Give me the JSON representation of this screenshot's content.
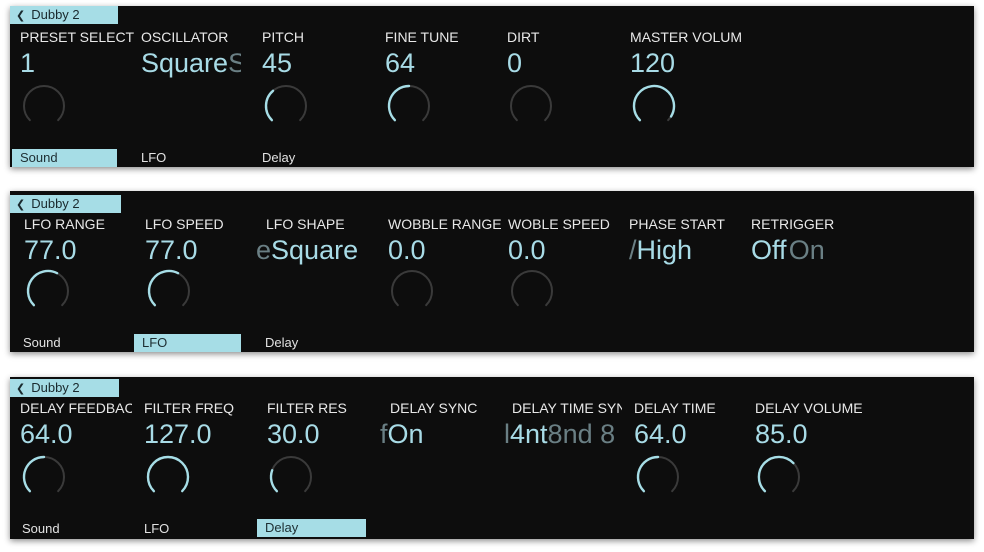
{
  "preset_name": "Dubby 2",
  "panels": [
    {
      "params": [
        {
          "label": "PRESET SELECT",
          "value": "1",
          "level": 0.0
        },
        {
          "label": "OSCILLATOR",
          "value": "Square",
          "ghost_after": "S",
          "level": null
        },
        {
          "label": "PITCH",
          "value": "45",
          "level": 0.35
        },
        {
          "label": "FINE TUNE",
          "value": "64",
          "level": 0.5
        },
        {
          "label": "DIRT",
          "value": "0",
          "level": 0.0
        },
        {
          "label": "MASTER VOLUME",
          "value": "120",
          "level": 0.95
        }
      ],
      "tabs": [
        "Sound",
        "LFO",
        "Delay"
      ],
      "active_tab": 0
    },
    {
      "params": [
        {
          "label": "LFO RANGE",
          "value": "77.0",
          "level": 0.6
        },
        {
          "label": "LFO SPEED",
          "value": "77.0",
          "level": 0.6
        },
        {
          "label": "LFO SHAPE",
          "value": "Square",
          "ghost_before": "e",
          "level": null
        },
        {
          "label": "WOBBLE RANGE",
          "value": "0.0",
          "level": 0.0
        },
        {
          "label": "WOBLE SPEED",
          "value": "0.0",
          "level": 0.0
        },
        {
          "label": "PHASE START",
          "value": "High",
          "ghost_before": "/",
          "level": null
        },
        {
          "label": "RETRIGGER",
          "value": "Off",
          "ghost_after": "On",
          "level": null
        }
      ],
      "tabs": [
        "Sound",
        "LFO",
        "Delay"
      ],
      "active_tab": 1
    },
    {
      "params": [
        {
          "label": "DELAY FEEDBACK",
          "value": "64.0",
          "level": 0.5
        },
        {
          "label": "FILTER FREQ",
          "value": "127.0",
          "level": 1.0
        },
        {
          "label": "FILTER RES",
          "value": "30.0",
          "level": 0.24
        },
        {
          "label": "DELAY SYNC",
          "value": "On",
          "ghost_before": "f",
          "level": null
        },
        {
          "label": "DELAY TIME SYNC",
          "value": "4nt",
          "ghost_before": "l",
          "ghost_after": "8nd 8",
          "level": null
        },
        {
          "label": "DELAY TIME",
          "value": "64.0",
          "level": 0.5
        },
        {
          "label": "DELAY VOLUME",
          "value": "85.0",
          "level": 0.67
        }
      ],
      "tabs": [
        "Sound",
        "LFO",
        "Delay"
      ],
      "active_tab": 2
    }
  ],
  "colors": {
    "panel_bg": "#0d0d0d",
    "accent": "#a6dde6",
    "knob_track": "#3a3a3a",
    "label": "#e8e8e8"
  }
}
